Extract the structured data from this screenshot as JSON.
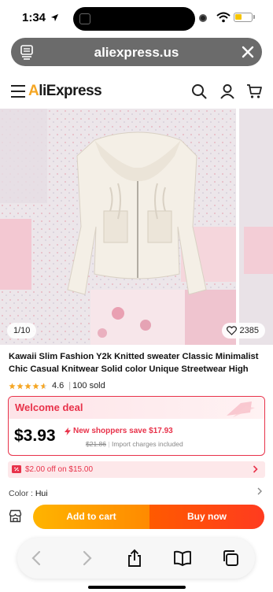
{
  "status_bar": {
    "time": "1:34"
  },
  "browser": {
    "url": "aliexpress.us"
  },
  "site": {
    "logo_text": "AliExpress"
  },
  "gallery": {
    "counter": "1/10",
    "wishlist_count": "2385"
  },
  "product": {
    "title": "Kawaii Slim Fashion Y2k Knitted sweater Classic Minimalist Chic Casual Knitwear Solid color Unique Streetwear High",
    "rating": "4.6",
    "sold": "100 sold",
    "stars_filled": 4.6
  },
  "deal": {
    "title": "Welcome deal",
    "price": "$3.93",
    "save_text": "New shoppers save $17.93",
    "original_price": "$21.86",
    "import_note": "Import charges included"
  },
  "coupon": {
    "text": "$2.00 off on $15.00"
  },
  "variant": {
    "label": "Color : ",
    "value": "Hui"
  },
  "actions": {
    "add_to_cart": "Add to cart",
    "buy_now": "Buy now"
  },
  "colors": {
    "accent": "#e8324a",
    "cart_orange": "#ff9a00",
    "buy_red": "#ff4a12"
  }
}
